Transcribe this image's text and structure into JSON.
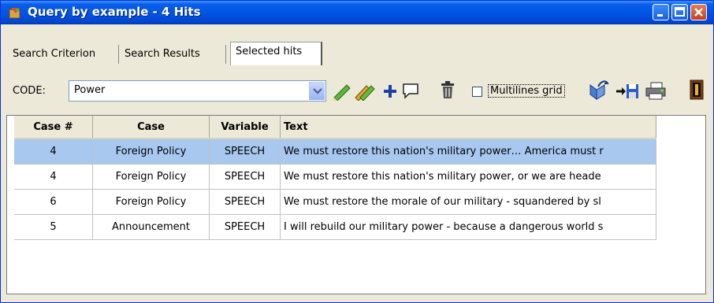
{
  "window": {
    "title": "Query by example - 4 Hits"
  },
  "tabs": [
    {
      "label": "Search Criterion"
    },
    {
      "label": "Search Results"
    },
    {
      "label": "Selected hits"
    }
  ],
  "toolbar": {
    "code_label": "CODE:",
    "code_value": "Power",
    "multilines_label": "Multilines grid",
    "multilines_checked": false,
    "icons": [
      "code-pencil-icon",
      "multi-code-pencil-icon",
      "add-icon",
      "comment-icon",
      "delete-icon",
      "export-icon",
      "save-icon",
      "print-icon",
      "exit-icon"
    ]
  },
  "grid": {
    "columns": [
      "Case #",
      "Case",
      "Variable",
      "Text"
    ],
    "rows": [
      {
        "case_num": "4",
        "case": "Foreign Policy",
        "variable": "SPEECH",
        "text": "We must restore this nation's military power… America must r",
        "selected": true
      },
      {
        "case_num": "4",
        "case": "Foreign Policy",
        "variable": "SPEECH",
        "text": "We must restore this nation's military power, or we are heade",
        "selected": false
      },
      {
        "case_num": "6",
        "case": "Foreign Policy",
        "variable": "SPEECH",
        "text": "We must restore the morale of our military - squandered by sl",
        "selected": false
      },
      {
        "case_num": "5",
        "case": "Announcement",
        "variable": "SPEECH",
        "text": "I will rebuild our military power - because a dangerous world s",
        "selected": false
      }
    ]
  },
  "colors": {
    "titlebar": "#0055e5",
    "selected_row": "#a8c8f0"
  }
}
